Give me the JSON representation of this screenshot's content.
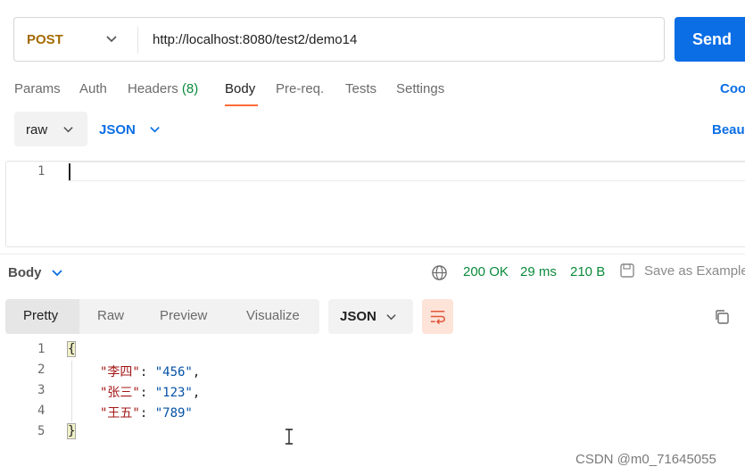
{
  "request": {
    "method": "POST",
    "url": "http://localhost:8080/test2/demo14",
    "send_label": "Send"
  },
  "request_tabs": {
    "params": "Params",
    "auth": "Auth",
    "headers": "Headers",
    "headers_count": "(8)",
    "body": "Body",
    "prereq": "Pre-req.",
    "tests": "Tests",
    "settings": "Settings",
    "cookies": "Coo"
  },
  "body_options": {
    "mode": "raw",
    "language": "JSON",
    "beautify": "Beau"
  },
  "editor": {
    "line_number": "1"
  },
  "response": {
    "section_label": "Body",
    "status": "200 OK",
    "time": "29 ms",
    "size": "210 B",
    "save_label": "Save as Example",
    "tabs": [
      "Pretty",
      "Raw",
      "Preview",
      "Visualize"
    ],
    "format": "JSON",
    "lines": [
      {
        "num": "1",
        "text": "{"
      },
      {
        "num": "2",
        "key": "\"李四\"",
        "value": "\"456\"",
        "sep": ",",
        "colon": ": "
      },
      {
        "num": "3",
        "key": "\"张三\"",
        "value": "\"123\"",
        "sep": ",",
        "colon": ": "
      },
      {
        "num": "4",
        "key": "\"王五\"",
        "value": "\"789\"",
        "sep": "",
        "colon": ": "
      },
      {
        "num": "5",
        "text": "}"
      }
    ]
  },
  "watermark": "CSDN @m0_71645055",
  "colors": {
    "accent": "#0b6ee5",
    "method": "#a36a00",
    "status_ok": "#0a8a3a",
    "tab_active_underline": "#ff6c37"
  }
}
